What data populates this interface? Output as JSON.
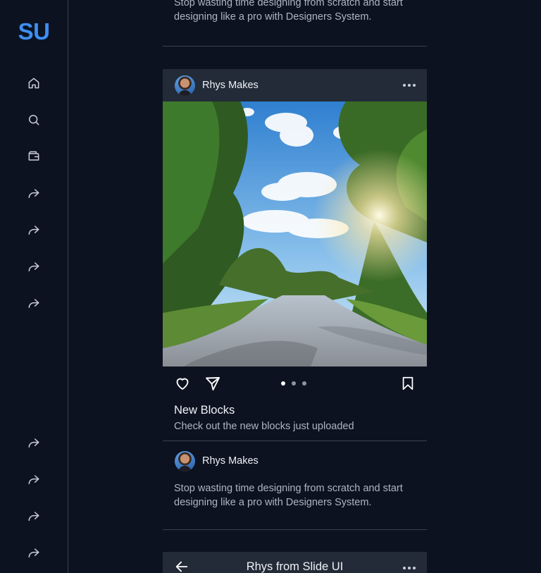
{
  "sidebar": {
    "logo": "SU",
    "top_icons": [
      "home-icon",
      "search-icon",
      "wallet-icon",
      "share-icon",
      "share-icon",
      "share-icon",
      "share-icon"
    ],
    "bottom_icons": [
      "share-icon",
      "share-icon",
      "share-icon",
      "share-icon"
    ]
  },
  "feed": {
    "top_post_text": "Stop wasting time designing from scratch and start designing like a pro with Designers System.",
    "card": {
      "author": "Rhys Makes",
      "title": "New Blocks",
      "subtitle": "Check out the new blocks just uploaded",
      "carousel_count": 3,
      "carousel_active": 1
    },
    "post2": {
      "author": "Rhys Makes",
      "text": "Stop wasting time designing from scratch and start designing like a pro with Designers System."
    },
    "chat_bar": {
      "title": "Rhys from Slide UI"
    }
  },
  "colors": {
    "background": "#0c1220",
    "card_header": "#232b38",
    "accent": "#3d8ef0",
    "divider": "#3a4150"
  }
}
